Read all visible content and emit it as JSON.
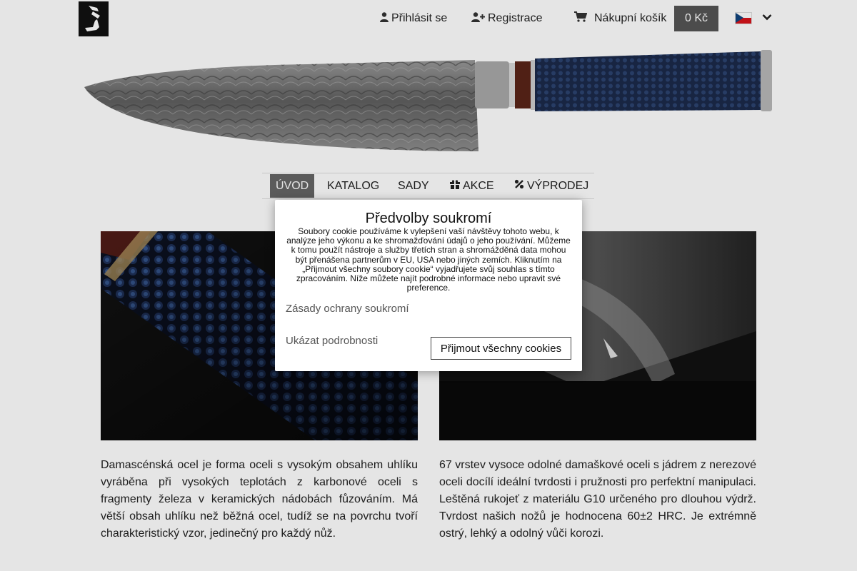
{
  "header": {
    "login_label": "Přihlásit se",
    "register_label": "Registrace",
    "cart_label": "Nákupní košík",
    "cart_total": "0 Kč"
  },
  "icons": {
    "logo": "brand-logo",
    "login": "user-icon",
    "register": "user-plus-icon",
    "cart": "shopping-cart-icon",
    "language": "czech-flag-icon",
    "dropdown": "chevron-down-icon",
    "gift": "gift-icon",
    "percent": "percent-icon"
  },
  "nav": {
    "items": [
      {
        "label": "ÚVOD",
        "active": true
      },
      {
        "label": "KATALOG"
      },
      {
        "label": "SADY"
      },
      {
        "label": "AKCE"
      },
      {
        "label": "VÝPRODEJ"
      }
    ]
  },
  "content": {
    "left_text": "Damascénská ocel je forma oceli s vysokým obsahem uhlíku vyráběna při vysokých teplotách z karbonové oceli s fragmenty železa v keramických nádobách fůzováním. Má větší obsah uhlíku než běžná ocel, tudíž se na povrchu tvoří charakteristický vzor, jedinečný pro každý nůž.",
    "right_text": "67 vrstev vysoce odolné damaškové oceli s jádrem z nerezové oceli docílí ideální tvrdosti i pružnosti pro perfektní manipulaci. Leštěná rukojeť z materiálu G10 určeného pro dlouhou výdrž. Tvrdost našich nožů je hodnocena 60±2 HRC. Je extrémně ostrý, lehký a odolný vůči korozi."
  },
  "cookie_modal": {
    "title": "Předvolby soukromí",
    "text": "Soubory cookie používáme k vylepšení vaší návštěvy tohoto webu, k analýze jeho výkonu a ke shromažďování údajů o jeho používání. Můžeme k tomu použít nástroje a služby třetích stran a shromážděná data mohou být přenášena partnerům v EU, USA nebo jiných zemích. Kliknutím na „Přijmout všechny soubory cookie“ vyjadřujete svůj souhlas s tímto zpracováním. Níže můžete najít podrobné informace nebo upravit své preference.",
    "privacy_link": "Zásady ochrany soukromí",
    "details_link": "Ukázat podrobnosti",
    "accept_button": "Přijmout všechny cookies"
  },
  "colors": {
    "nav_active_bg": "#666666",
    "cart_total_bg": "#555555",
    "overlay": "rgba(0,0,0,0.1)"
  }
}
